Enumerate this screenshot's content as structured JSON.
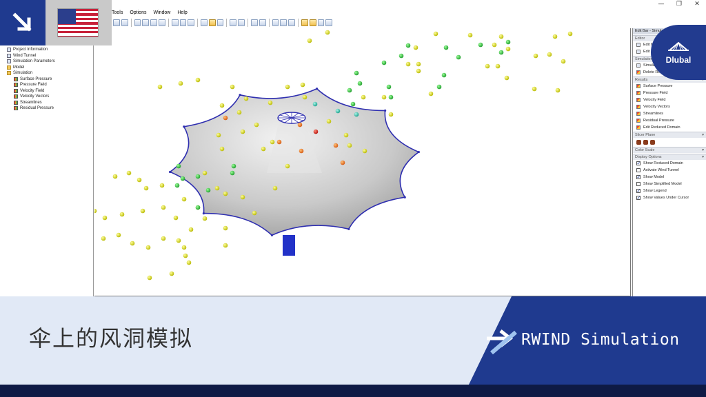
{
  "menu": [
    "Tools",
    "Options",
    "Window",
    "Help"
  ],
  "window_controls": [
    "—",
    "❐",
    "✕"
  ],
  "navigator": {
    "items": [
      {
        "label": "Project Information",
        "level": 0,
        "icon": "document-icon"
      },
      {
        "label": "Wind Tunnel",
        "level": 0,
        "icon": "document-icon"
      },
      {
        "label": "Simulation Parameters",
        "level": 0,
        "icon": "document-icon"
      },
      {
        "label": "Model",
        "level": 0,
        "icon": "folder-icon"
      },
      {
        "label": "Simulation",
        "level": 0,
        "icon": "folder-icon"
      },
      {
        "label": "Surface Pressure",
        "level": 1,
        "icon": "result-icon"
      },
      {
        "label": "Pressure Field",
        "level": 1,
        "icon": "result-icon"
      },
      {
        "label": "Velocity Field",
        "level": 1,
        "icon": "result-icon"
      },
      {
        "label": "Velocity Vectors",
        "level": 1,
        "icon": "result-icon"
      },
      {
        "label": "Streamlines",
        "level": 1,
        "icon": "result-icon"
      },
      {
        "label": "Residual Pressure",
        "level": 1,
        "icon": "result-icon"
      }
    ]
  },
  "panel": {
    "title": "Edit Bar - Simula",
    "editor_section": "Editor",
    "editor_items": [
      "Edit M",
      "Edit"
    ],
    "simulation_section": "Simulation",
    "simulation_items": [
      "Simulat",
      "Delete Res"
    ],
    "results_section": "Results",
    "results_items": [
      "Surface Pressure",
      "Pressure Field",
      "Velocity Field",
      "Velocity Vectors",
      "Streamlines",
      "Residual Pressure",
      "Edit Reduced Domain"
    ],
    "slicer_section": "Slicer Plane",
    "color_section": "Color Scale",
    "display_section": "Display Options",
    "display_options": [
      {
        "label": "Show Reduced Domain",
        "checked": true
      },
      {
        "label": "Activate Wind Tunnel",
        "checked": false
      },
      {
        "label": "Show Model",
        "checked": true
      },
      {
        "label": "Show Simplified Model",
        "checked": false
      },
      {
        "label": "Show Legend",
        "checked": true
      },
      {
        "label": "Show Values Under Cursor",
        "checked": true
      }
    ]
  },
  "brand": {
    "name": "Dlubal",
    "color": "#223b8f"
  },
  "banner": {
    "caption": "伞上的风洞模拟",
    "product": "RWIND Simulation"
  },
  "colors": {
    "accent_blue": "#223b8f",
    "banner_light": "#e1e9f6",
    "footer": "#0e1a45"
  }
}
